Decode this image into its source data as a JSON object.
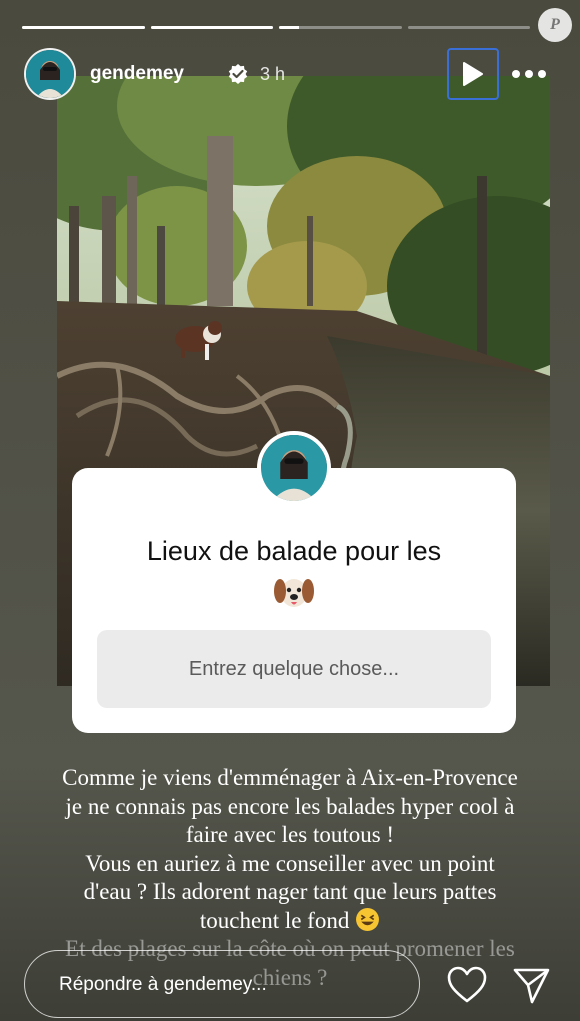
{
  "story": {
    "progress": [
      1,
      1,
      0.16,
      0
    ],
    "watermark": "P",
    "username": "gendemey",
    "time": "3 h"
  },
  "question": {
    "title": "Lieux de balade pour les",
    "emoji_icon": "dog-face-icon",
    "input_placeholder": "Entrez quelque chose..."
  },
  "caption": {
    "line1": "Comme je viens d'emménager à Aix-en-Provence",
    "line2": "je ne connais pas encore les balades hyper cool à",
    "line3": "faire avec les toutous !",
    "line4": "Vous en auriez à me conseiller avec un point",
    "line5": "d'eau ? Ils adorent nager tant que leurs pattes",
    "line6": "touchent le fond",
    "line7": "Et des plages sur la côte où on peut promener les",
    "line8": "chiens ?"
  },
  "reply": {
    "placeholder": "Répondre à gendemey..."
  },
  "colors": {
    "focus_ring": "#3a6fd8",
    "card_bg": "#ffffff",
    "input_bg": "#ebebeb"
  }
}
